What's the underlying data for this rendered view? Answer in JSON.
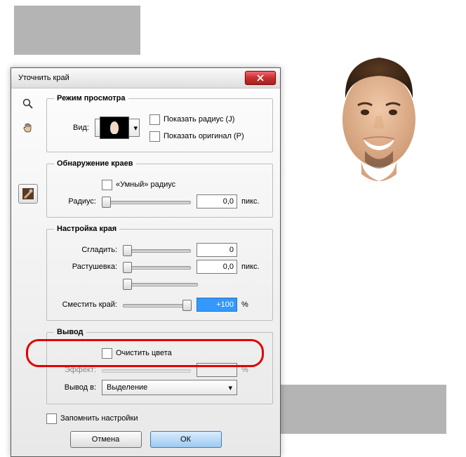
{
  "title": "Уточнить край",
  "viewMode": {
    "legend": "Режим просмотра",
    "viewLabel": "Вид:",
    "showRadius": "Показать радиус (J)",
    "showOriginal": "Показать оригинал (P)"
  },
  "edgeDetect": {
    "legend": "Обнаружение краев",
    "smartRadius": "«Умный» радиус",
    "radiusLabel": "Радиус:",
    "radiusValue": "0,0",
    "radiusUnit": "пикс."
  },
  "adjust": {
    "legend": "Настройка края",
    "smoothLabel": "Сгладить:",
    "smoothValue": "0",
    "featherLabel": "Растушевка:",
    "featherValue": "0,0",
    "featherUnit": "пикс.",
    "shiftLabel": "Сместить край:",
    "shiftValue": "+100",
    "shiftUnit": "%"
  },
  "output": {
    "legend": "Вывод",
    "decontaminate": "Очистить цвета",
    "amountLabel": "Эффект:",
    "amountUnit": "%",
    "outputToLabel": "Вывод в:",
    "outputToValue": "Выделение"
  },
  "remember": "Запомнить настройки",
  "cancel": "Отмена",
  "ok": "ОК"
}
